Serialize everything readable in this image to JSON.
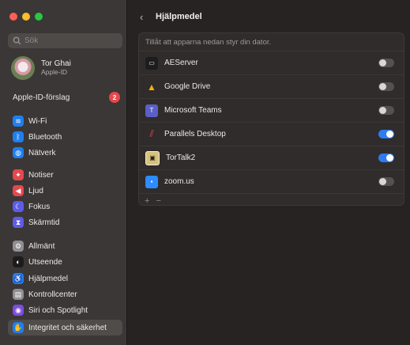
{
  "sidebar": {
    "search_placeholder": "Sök",
    "profile": {
      "name": "Tor Ghai",
      "subtitle": "Apple-ID"
    },
    "suggestion": {
      "label": "Apple-ID-förslag",
      "badge": "2"
    },
    "items": [
      {
        "label": "Wi-Fi",
        "icon": "wifi-icon",
        "color": "#1f7ff0"
      },
      {
        "label": "Bluetooth",
        "icon": "bluetooth-icon",
        "color": "#1f7ff0"
      },
      {
        "label": "Nätverk",
        "icon": "globe-icon",
        "color": "#1f7ff0"
      },
      {
        "label": "Notiser",
        "icon": "bell-icon",
        "color": "#e5484d"
      },
      {
        "label": "Ljud",
        "icon": "speaker-icon",
        "color": "#e5484d"
      },
      {
        "label": "Fokus",
        "icon": "moon-icon",
        "color": "#5e5ce6"
      },
      {
        "label": "Skärmtid",
        "icon": "hourglass-icon",
        "color": "#5e5ce6"
      },
      {
        "label": "Allmänt",
        "icon": "gear-icon",
        "color": "#8e8e93"
      },
      {
        "label": "Utseende",
        "icon": "appearance-icon",
        "color": "#1c1c1e"
      },
      {
        "label": "Hjälpmedel",
        "icon": "accessibility-icon",
        "color": "#1f7ff0"
      },
      {
        "label": "Kontrollcenter",
        "icon": "control-center-icon",
        "color": "#8e8e93"
      },
      {
        "label": "Siri och Spotlight",
        "icon": "siri-icon",
        "color": "#7d4ce0"
      },
      {
        "label": "Integritet och säkerhet",
        "icon": "hand-icon",
        "color": "#1f7ff0",
        "active": true
      }
    ]
  },
  "header": {
    "back": "‹",
    "title": "Hjälpmedel"
  },
  "panel": {
    "description": "Tillåt att apparna nedan styr din dator.",
    "apps": [
      {
        "name": "AEServer",
        "icon": "terminal-icon",
        "enabled": false
      },
      {
        "name": "Google Drive",
        "icon": "google-drive-icon",
        "enabled": false
      },
      {
        "name": "Microsoft Teams",
        "icon": "teams-icon",
        "enabled": false
      },
      {
        "name": "Parallels Desktop",
        "icon": "parallels-icon",
        "enabled": true
      },
      {
        "name": "TorTalk2",
        "icon": "tortalk-icon",
        "enabled": true
      },
      {
        "name": "zoom.us",
        "icon": "zoom-icon",
        "enabled": false
      }
    ],
    "add": "+",
    "remove": "−"
  }
}
